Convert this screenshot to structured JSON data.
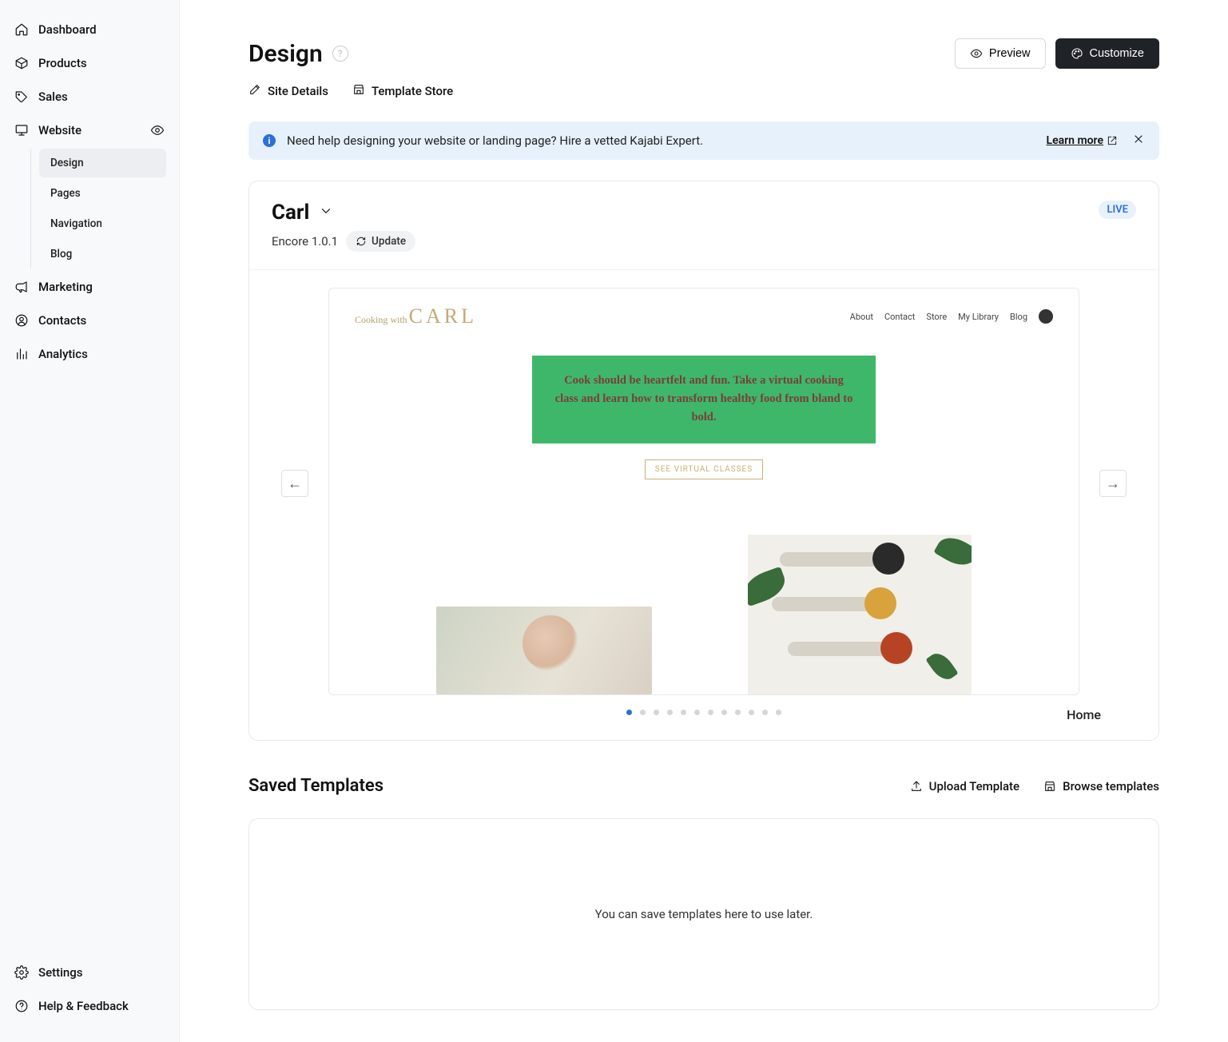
{
  "sidebar": {
    "items": [
      {
        "label": "Dashboard"
      },
      {
        "label": "Products"
      },
      {
        "label": "Sales"
      },
      {
        "label": "Website"
      },
      {
        "label": "Marketing"
      },
      {
        "label": "Contacts"
      },
      {
        "label": "Analytics"
      }
    ],
    "website_sub": [
      {
        "label": "Design"
      },
      {
        "label": "Pages"
      },
      {
        "label": "Navigation"
      },
      {
        "label": "Blog"
      }
    ],
    "bottom": [
      {
        "label": "Settings"
      },
      {
        "label": "Help & Feedback"
      }
    ]
  },
  "header": {
    "title": "Design",
    "preview": "Preview",
    "customize": "Customize"
  },
  "tabs": {
    "site_details": "Site Details",
    "template_store": "Template Store"
  },
  "banner": {
    "text": "Need help designing your website or landing page? Hire a vetted Kajabi Expert.",
    "learn_more": "Learn more"
  },
  "site_card": {
    "name": "Carl",
    "theme": "Encore 1.0.1",
    "update": "Update",
    "status": "LIVE"
  },
  "site_preview": {
    "logo_script": "Cooking with",
    "logo_big": "CARL",
    "nav": [
      "About",
      "Contact",
      "Store",
      "My Library",
      "Blog"
    ],
    "hero": "Cook should be heartfelt and fun. Take a virtual cooking class and learn how to transform healthy food from bland to bold.",
    "cta": "SEE VIRTUAL CLASSES",
    "current_page": "Home",
    "dot_count": 12
  },
  "saved_templates": {
    "title": "Saved Templates",
    "upload": "Upload Template",
    "browse": "Browse templates",
    "empty": "You can save templates here to use later."
  }
}
